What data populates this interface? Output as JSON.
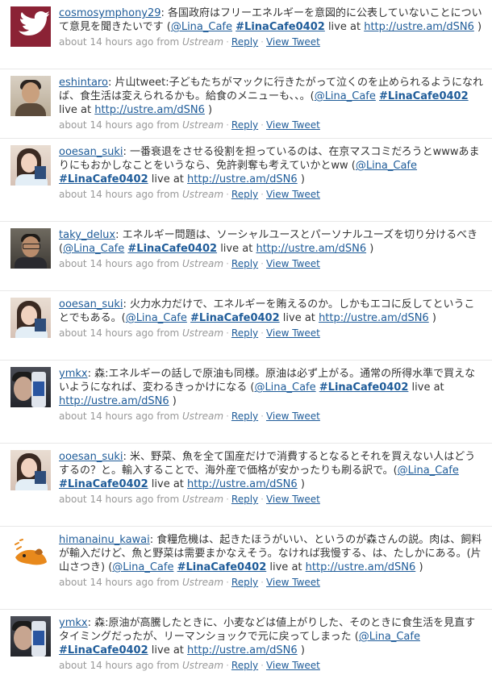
{
  "colors": {
    "link": "#1f5c99",
    "meta": "#999999",
    "text": "#333333",
    "avatar_bird_bg": "#8b2235"
  },
  "tweets": [
    {
      "user": "cosmosymphony29",
      "avatar_icon": "twitter-bird-icon",
      "text": ": 各国政府はフリーエネルギーを意図的に公表していないことについて意見を聞きたいです (",
      "mention": "@Lina_Cafe",
      "hashtag": "#LinaCafe0402",
      "live_at": "live at",
      "url": "http://ustre.am/dSN6",
      "close": ")",
      "time": "about 14 hours ago from",
      "source": "Ustream",
      "reply": "Reply",
      "view": "View Tweet"
    },
    {
      "user": "eshintaro",
      "avatar_icon": "user-photo-icon",
      "text": ": 片山tweet:子どもたちがマックに行きたがって泣くのを止められるようになれば、食生活は変えられるかも。給食のメニューも、、。(",
      "mention": "@Lina_Cafe",
      "hashtag": "#LinaCafe0402",
      "live_at": "live at",
      "url": "http://ustre.am/dSN6",
      "close": ")",
      "time": "about 14 hours ago from",
      "source": "Ustream",
      "reply": "Reply",
      "view": "View Tweet"
    },
    {
      "user": "ooesan_suki",
      "avatar_icon": "user-photo-icon",
      "text": ": 一番衰退をさせる役割を担っているのは、在京マスコミだろうとwwwあまりにもおかしなことをいうなら、免許剥奪も考えていかとww (",
      "mention": "@Lina_Cafe",
      "hashtag": "#LinaCafe0402",
      "live_at": "live at",
      "url": "http://ustre.am/dSN6",
      "close": ")",
      "time": "about 14 hours ago from",
      "source": "Ustream",
      "reply": "Reply",
      "view": "View Tweet"
    },
    {
      "user": "taky_delux",
      "avatar_icon": "user-photo-icon",
      "text": ": エネルギー問題は、ソーシャルユースとパーソナルユーズを切り分けるべき (",
      "mention": "@Lina_Cafe",
      "hashtag": "#LinaCafe0402",
      "live_at": "live at",
      "url": "http://ustre.am/dSN6",
      "close": ")",
      "time": "about 14 hours ago from",
      "source": "Ustream",
      "reply": "Reply",
      "view": "View Tweet"
    },
    {
      "user": "ooesan_suki",
      "avatar_icon": "user-photo-icon",
      "text": ": 火力水力だけで、エネルギーを賄えるのか。しかもエコに反してということでもある。(",
      "mention": "@Lina_Cafe",
      "hashtag": "#LinaCafe0402",
      "live_at": "live at",
      "url": "http://ustre.am/dSN6",
      "close": ")",
      "time": "about 14 hours ago from",
      "source": "Ustream",
      "reply": "Reply",
      "view": "View Tweet"
    },
    {
      "user": "ymkx",
      "avatar_icon": "user-photo-icon",
      "text": ": 森:エネルギーの話しで原油も同様。原油は必ず上がる。通常の所得水準で買えないようになれば、変わるきっかけになる (",
      "mention": "@Lina_Cafe",
      "hashtag": "#LinaCafe0402",
      "live_at": "live at",
      "url": "http://ustre.am/dSN6",
      "close": ")",
      "time": "about 14 hours ago from",
      "source": "Ustream",
      "reply": "Reply",
      "view": "View Tweet"
    },
    {
      "user": "ooesan_suki",
      "avatar_icon": "user-photo-icon",
      "text": ": 米、野菜、魚を全て国産だけで消費するとなるとそれを買えない人はどうするの？と。輸入することで、海外産で価格が安かったりも刷る訳で。(",
      "mention": "@Lina_Cafe",
      "hashtag": "#LinaCafe0402",
      "live_at": "live at",
      "url": "http://ustre.am/dSN6",
      "close": ")",
      "time": "about 14 hours ago from",
      "source": "Ustream",
      "reply": "Reply",
      "view": "View Tweet"
    },
    {
      "user": "himanainu_kawai",
      "avatar_icon": "dog-avatar-icon",
      "text": ": 食糧危機は、起きたほうがいい、というのが森さんの説。肉は、飼料が輸入だけど、魚と野菜は需要まかなえそう。なければ我慢する、は、たしかにある。(片山さつき) (",
      "mention": "@Lina_Cafe",
      "hashtag": "#LinaCafe0402",
      "live_at": "live at",
      "url": "http://ustre.am/dSN6",
      "close": ")",
      "time": "about 14 hours ago from",
      "source": "Ustream",
      "reply": "Reply",
      "view": "View Tweet"
    },
    {
      "user": "ymkx",
      "avatar_icon": "user-photo-icon",
      "text": ": 森:原油が高騰したときに、小麦などは値上がりした、そのときに食生活を見直すタイミングだったが、リーマンショックで元に戻ってしまった (",
      "mention": "@Lina_Cafe",
      "hashtag": "#LinaCafe0402",
      "live_at": "live at",
      "url": "http://ustre.am/dSN6",
      "close": ")",
      "time": "about 14 hours ago from",
      "source": "Ustream",
      "reply": "Reply",
      "view": "View Tweet"
    }
  ]
}
